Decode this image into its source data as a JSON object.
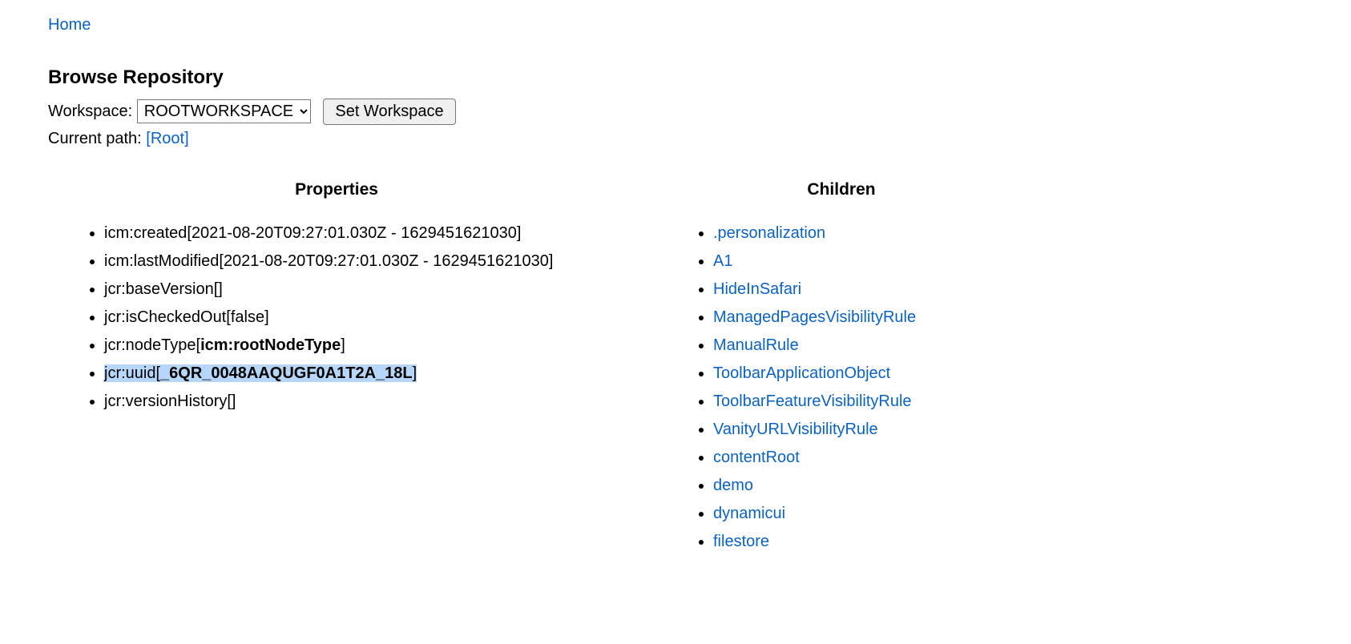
{
  "home_link": "Home",
  "page_heading": "Browse Repository",
  "workspace_label": "Workspace:",
  "workspace_selected": "ROOTWORKSPACE",
  "set_workspace_button": "Set Workspace",
  "current_path_label": "Current path:",
  "current_path_link": "[Root]",
  "properties_heading": "Properties",
  "children_heading": "Children",
  "properties": [
    {
      "name": "icm:created",
      "value": "2021-08-20T09:27:01.030Z - 1629451621030",
      "bold": false,
      "highlight": false
    },
    {
      "name": "icm:lastModified",
      "value": "2021-08-20T09:27:01.030Z - 1629451621030",
      "bold": false,
      "highlight": false
    },
    {
      "name": "jcr:baseVersion",
      "value": "",
      "bold": false,
      "highlight": false
    },
    {
      "name": "jcr:isCheckedOut",
      "value": "false",
      "bold": false,
      "highlight": false
    },
    {
      "name": "jcr:nodeType",
      "value": "icm:rootNodeType",
      "bold": true,
      "highlight": false
    },
    {
      "name": "jcr:uuid",
      "value": "_6QR_0048AAQUGF0A1T2A_18L",
      "bold": true,
      "highlight": true
    },
    {
      "name": "jcr:versionHistory",
      "value": "",
      "bold": false,
      "highlight": false
    }
  ],
  "children": [
    ".personalization",
    "A1",
    "HideInSafari",
    "ManagedPagesVisibilityRule",
    "ManualRule",
    "ToolbarApplicationObject",
    "ToolbarFeatureVisibilityRule",
    "VanityURLVisibilityRule",
    "contentRoot",
    "demo",
    "dynamicui",
    "filestore"
  ]
}
